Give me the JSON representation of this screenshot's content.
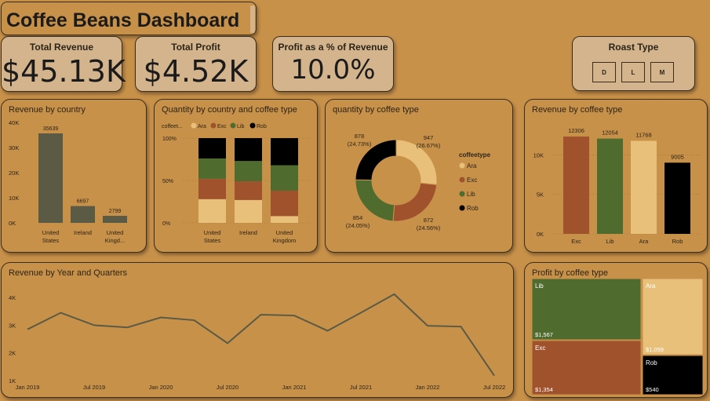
{
  "title": "Coffee Beans Dashboard",
  "kpis": {
    "total_revenue_label": "Total Revenue",
    "total_revenue_value": "$45.13K",
    "total_profit_label": "Total Profit",
    "total_profit_value": "$4.52K",
    "profit_pct_label": "Profit as a % of Revenue",
    "profit_pct_value": "10.0%"
  },
  "roast": {
    "title": "Roast Type",
    "options": [
      "D",
      "L",
      "M"
    ]
  },
  "colors": {
    "Ara": "#E8C07A",
    "Exc": "#A0522D",
    "Lib": "#4F6B2E",
    "Rob": "#000000",
    "country": "#5A5A45",
    "line": "#5A5A45"
  },
  "chart_data": [
    {
      "id": "revenue_by_country",
      "type": "bar",
      "title": "Revenue by country",
      "categories": [
        "United States",
        "Ireland",
        "United Kingd..."
      ],
      "values": [
        35639,
        6697,
        2799
      ],
      "data_labels": [
        "35639",
        "6697",
        "2799"
      ],
      "yticks": [
        "0K",
        "10K",
        "20K",
        "30K",
        "40K"
      ],
      "ylim": [
        0,
        40000
      ]
    },
    {
      "id": "quantity_by_country_type",
      "type": "bar",
      "stacked": "100%",
      "title": "Quantity by country and coffee type",
      "legend_title": "coffeet...",
      "series_names": [
        "Ara",
        "Exc",
        "Lib",
        "Rob"
      ],
      "categories": [
        "United States",
        "Ireland",
        "United Kingdom"
      ],
      "series": [
        {
          "name": "Ara",
          "values": [
            0.28,
            0.27,
            0.08
          ]
        },
        {
          "name": "Exc",
          "values": [
            0.24,
            0.22,
            0.3
          ]
        },
        {
          "name": "Lib",
          "values": [
            0.24,
            0.24,
            0.3
          ]
        },
        {
          "name": "Rob",
          "values": [
            0.24,
            0.27,
            0.32
          ]
        }
      ],
      "yticks": [
        "0%",
        "50%",
        "100%"
      ]
    },
    {
      "id": "quantity_by_coffee_type",
      "type": "pie",
      "donut": true,
      "title": "quantity by coffee type",
      "legend_title": "coffeetype",
      "slices": [
        {
          "name": "Ara",
          "value": 947,
          "label": "947",
          "pct": "(26.67%)"
        },
        {
          "name": "Exc",
          "value": 872,
          "label": "872",
          "pct": "(24.56%)"
        },
        {
          "name": "Lib",
          "value": 854,
          "label": "854",
          "pct": "(24.05%)"
        },
        {
          "name": "Rob",
          "value": 878,
          "label": "878",
          "pct": "(24.73%)"
        }
      ]
    },
    {
      "id": "revenue_by_coffee_type",
      "type": "bar",
      "title": "Revenue by coffee type",
      "categories": [
        "Exc",
        "Lib",
        "Ara",
        "Rob"
      ],
      "values": [
        12306,
        12054,
        11768,
        9005
      ],
      "data_labels": [
        "12306",
        "12054",
        "11768",
        "9005"
      ],
      "yticks": [
        "0K",
        "5K",
        "10K"
      ],
      "ylim": [
        0,
        14000
      ]
    },
    {
      "id": "revenue_by_year_quarter",
      "type": "line",
      "title": "Revenue by Year and Quarters",
      "values": [
        2850,
        3450,
        3000,
        2920,
        3280,
        3180,
        2350,
        3380,
        3350,
        2800,
        3450,
        4120,
        2980,
        2950,
        1180
      ],
      "xticks": [
        "Jan 2019",
        "Jul 2019",
        "Jan 2020",
        "Jul 2020",
        "Jan 2021",
        "Jul 2021",
        "Jan 2022",
        "Jul 2022"
      ],
      "yticks": [
        "1K",
        "2K",
        "3K",
        "4K"
      ],
      "ylim": [
        1000,
        4400
      ]
    },
    {
      "id": "profit_by_coffee_type",
      "type": "treemap",
      "title": "Profit by coffee type",
      "items": [
        {
          "name": "Lib",
          "value": 1567,
          "label": "$1,567"
        },
        {
          "name": "Exc",
          "value": 1354,
          "label": "$1,354"
        },
        {
          "name": "Ara",
          "value": 1059,
          "label": "$1,059"
        },
        {
          "name": "Rob",
          "value": 540,
          "label": "$540"
        }
      ]
    }
  ]
}
